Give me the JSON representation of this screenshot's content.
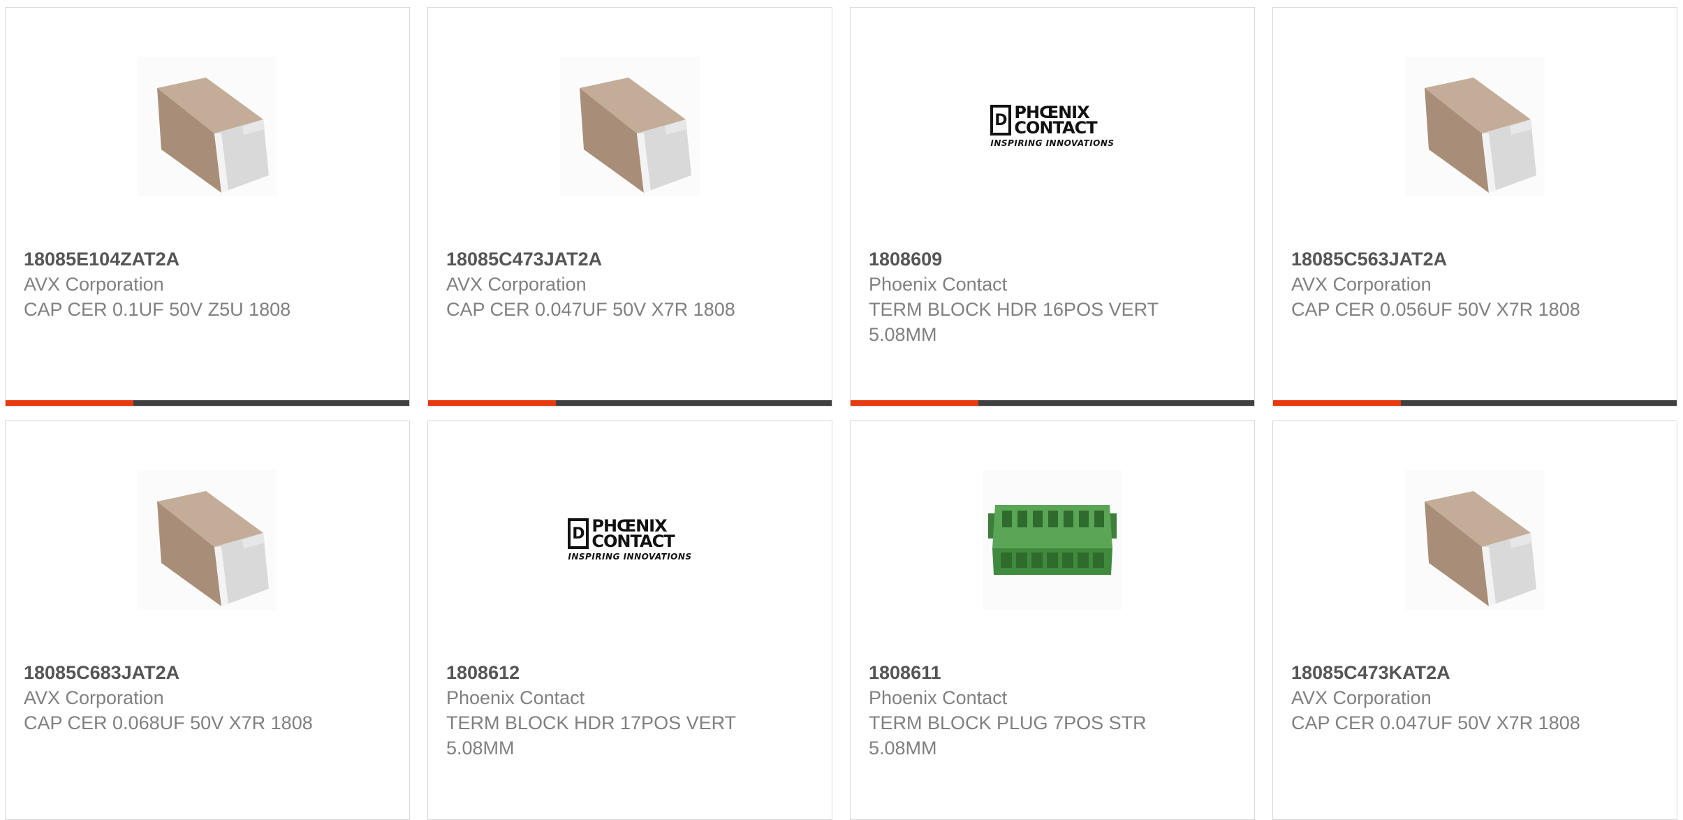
{
  "products": [
    {
      "part": "18085E104ZAT2A",
      "manufacturer": "AVX Corporation",
      "description": "CAP CER 0.1UF 50V Z5U 1808",
      "image": "ceramic-capacitor-icon"
    },
    {
      "part": "18085C473JAT2A",
      "manufacturer": "AVX Corporation",
      "description": "CAP CER 0.047UF 50V X7R 1808",
      "image": "ceramic-capacitor-icon"
    },
    {
      "part": "1808609",
      "manufacturer": "Phoenix Contact",
      "description": "TERM BLOCK HDR 16POS VERT 5.08MM",
      "image": "phoenix-contact-logo",
      "logo_words_1": "PHŒNIX",
      "logo_words_2": "CONTACT",
      "logo_tagline": "INSPIRING INNOVATIONS"
    },
    {
      "part": "18085C563JAT2A",
      "manufacturer": "AVX Corporation",
      "description": "CAP CER 0.056UF 50V X7R 1808",
      "image": "ceramic-capacitor-icon"
    },
    {
      "part": "18085C683JAT2A",
      "manufacturer": "AVX Corporation",
      "description": "CAP CER 0.068UF 50V X7R 1808",
      "image": "ceramic-capacitor-icon"
    },
    {
      "part": "1808612",
      "manufacturer": "Phoenix Contact",
      "description": "TERM BLOCK HDR 17POS VERT 5.08MM",
      "image": "phoenix-contact-logo",
      "logo_words_1": "PHŒNIX",
      "logo_words_2": "CONTACT",
      "logo_tagline": "INSPIRING INNOVATIONS"
    },
    {
      "part": "1808611",
      "manufacturer": "Phoenix Contact",
      "description": "TERM BLOCK PLUG 7POS STR 5.08MM",
      "image": "terminal-block-plug-icon"
    },
    {
      "part": "18085C473KAT2A",
      "manufacturer": "AVX Corporation",
      "description": "CAP CER 0.047UF 50V X7R 1808",
      "image": "ceramic-capacitor-icon"
    }
  ],
  "colors": {
    "accent": "#e8380d",
    "bar": "#404040",
    "text": "#808080",
    "part_text": "#555555",
    "capacitor_body": "#a88e78",
    "capacitor_end": "#d6d6d6",
    "terminal_green": "#4d9a4a"
  }
}
